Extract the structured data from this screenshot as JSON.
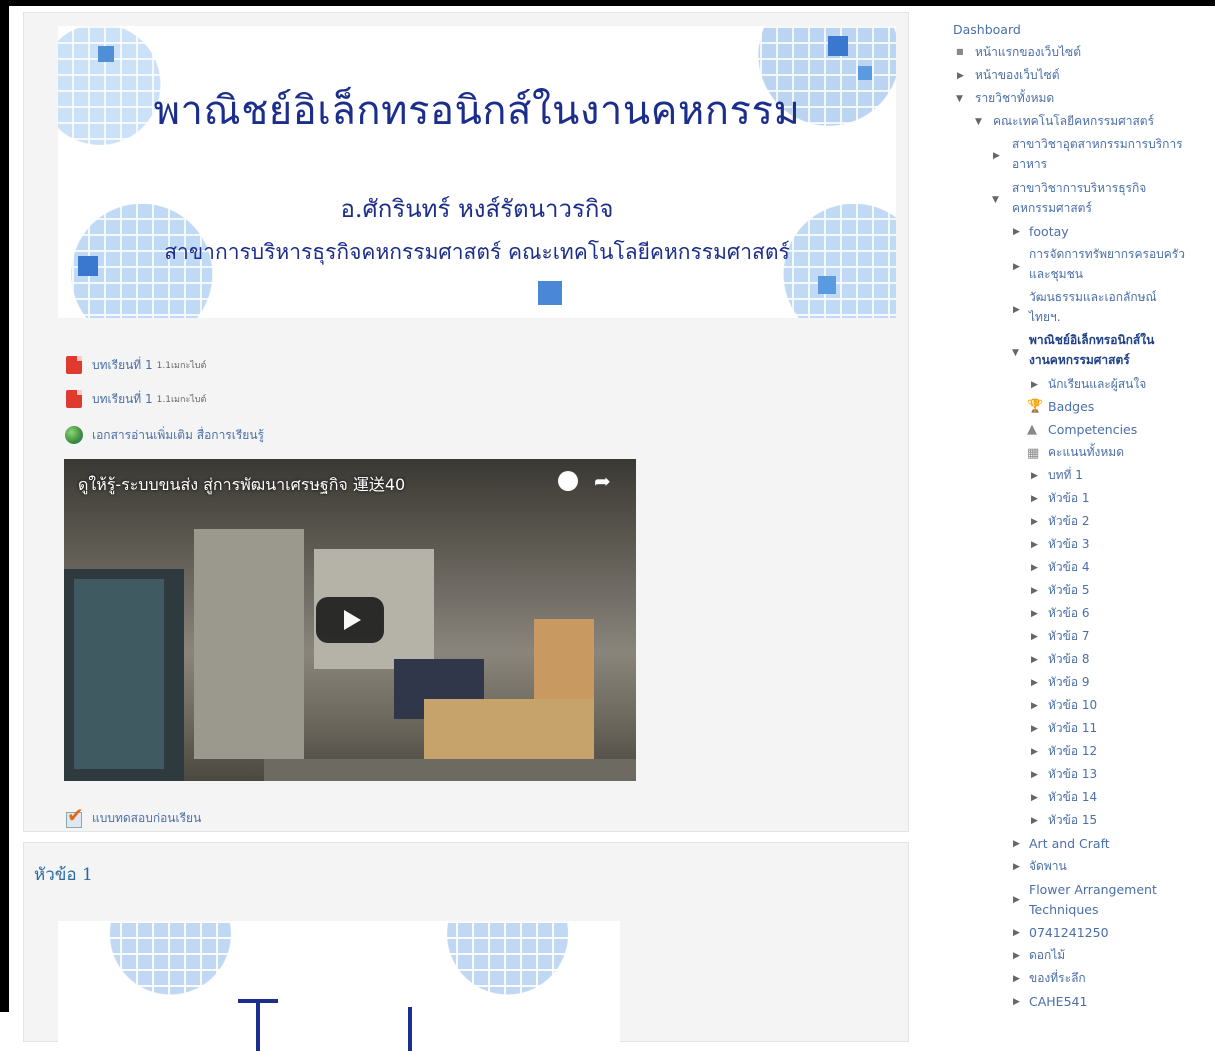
{
  "main": {
    "banner": {
      "title": "พาณิชย์อิเล็กทรอนิกส์ในงานคหกรรม",
      "author": "อ.ศักรินทร์ หงส์รัตนาวรกิจ",
      "department": "สาขาการบริหารธุรกิจคหกรรมศาสตร์ คณะเทคโนโลยีคหกรรมศาสตร์"
    },
    "activities": [
      {
        "label": "บทเรียนที่ 1",
        "size": "1.1เมกะไบต์",
        "icon": "pdf-icon"
      },
      {
        "label": "บทเรียนที่ 1",
        "size": "1.1เมกะไบต์",
        "icon": "pdf-icon"
      },
      {
        "label": "เอกสารอ่านเพิ่มเติม สื่อการเรียนรู้",
        "size": "",
        "icon": "globe-icon"
      }
    ],
    "video": {
      "title": "ดูให้รู้-ระบบขนส่ง สู่การพัฒนาเศรษฐกิจ   運送40"
    },
    "quiz": {
      "label": "แบบทดสอบก่อนเรียน",
      "icon": "quiz-icon"
    },
    "section2": {
      "title": "หัวข้อ 1"
    }
  },
  "sidebar": {
    "dashboard": "Dashboard",
    "site_home": "หน้าแรกของเว็บไซต์",
    "site_pages": "หน้าของเว็บไซต์",
    "all_courses": "รายวิชาทั้งหมด",
    "faculty": "คณะเทคโนโลยีคหกรรมศาสตร์",
    "dept_food_1": "สาขาวิชาอุตสาหกรรมการบริการ",
    "dept_food_2": "อาหาร",
    "dept_biz_1": "สาขาวิชาการบริหารธุรกิจ",
    "dept_biz_2": "คหกรรมศาสตร์",
    "footay": "footay",
    "family_1": "การจัดการทรัพยากรครอบครัว",
    "family_2": "และชุมชน",
    "culture_1": "วัฒนธรรมและเอกลักษณ์",
    "culture_2": "ไทยฯ.",
    "current_1": "พาณิชย์อิเล็กทรอนิกส์ใน",
    "current_2": "งานคหกรรมศาสตร์",
    "participants": "นักเรียนและผู้สนใจ",
    "badges": "Badges",
    "competencies": "Competencies",
    "grades": "คะแนนทั้งหมด",
    "chapter": "บทที่ 1",
    "topics": [
      "หัวข้อ 1",
      "หัวข้อ 2",
      "หัวข้อ 3",
      "หัวข้อ 4",
      "หัวข้อ 5",
      "หัวข้อ 6",
      "หัวข้อ 7",
      "หัวข้อ 8",
      "หัวข้อ 9",
      "หัวข้อ 10",
      "หัวข้อ 11",
      "หัวข้อ 12",
      "หัวข้อ 13",
      "หัวข้อ 14",
      "หัวข้อ 15"
    ],
    "art_craft": "Art and Craft",
    "jadpan": "จัดพาน",
    "flower_1": "Flower Arrangement",
    "flower_2": "Techniques",
    "code": "0741241250",
    "dokmai": "ดอกไม้",
    "souvenir": "ของที่ระลึก",
    "cahe": "CAHE541"
  }
}
